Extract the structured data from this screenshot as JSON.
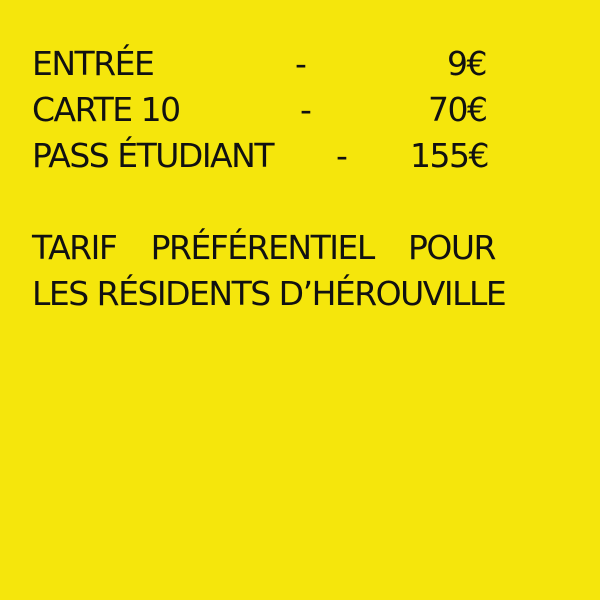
{
  "prices": [
    {
      "label": "ENTRÉE",
      "dash": "-",
      "value": "9€"
    },
    {
      "label": "CARTE 10",
      "dash": "-",
      "value": "70€"
    },
    {
      "label": "PASS ÉTUDIANT",
      "dash": "-",
      "value": "155€"
    }
  ],
  "note": {
    "line1_words": [
      "TARIF",
      "PRÉFÉRENTIEL",
      "POUR"
    ],
    "line2": "LES RÉSIDENTS D’HÉROUVILLE"
  },
  "colors": {
    "background": "#f5e60c",
    "text": "#111111"
  }
}
